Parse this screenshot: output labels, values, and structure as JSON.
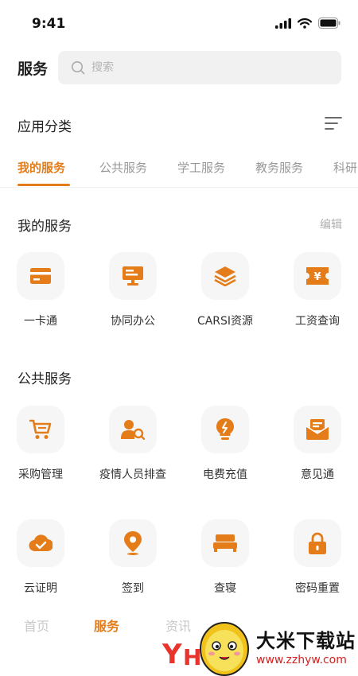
{
  "status_bar": {
    "time": "9:41"
  },
  "header": {
    "title": "服务",
    "search_placeholder": "搜索"
  },
  "category": {
    "title": "应用分类"
  },
  "tabs": [
    {
      "label": "我的服务",
      "active": true
    },
    {
      "label": "公共服务",
      "active": false
    },
    {
      "label": "学工服务",
      "active": false
    },
    {
      "label": "教务服务",
      "active": false
    },
    {
      "label": "科研",
      "active": false
    }
  ],
  "my_services": {
    "title": "我的服务",
    "action": "编辑",
    "items": [
      {
        "label": "一卡通",
        "icon": "card-icon"
      },
      {
        "label": "协同办公",
        "icon": "monitor-icon"
      },
      {
        "label": "CARSI资源",
        "icon": "layers-icon"
      },
      {
        "label": "工资查询",
        "icon": "yuan-ticket-icon"
      }
    ]
  },
  "public_services": {
    "title": "公共服务",
    "items": [
      {
        "label": "采购管理",
        "icon": "cart-icon"
      },
      {
        "label": "疫情人员排查",
        "icon": "person-search-icon"
      },
      {
        "label": "电费充值",
        "icon": "bulb-icon"
      },
      {
        "label": "意见通",
        "icon": "mail-icon"
      },
      {
        "label": "云证明",
        "icon": "cloud-check-icon"
      },
      {
        "label": "签到",
        "icon": "location-pin-icon"
      },
      {
        "label": "查寝",
        "icon": "bed-icon"
      },
      {
        "label": "密码重置",
        "icon": "lock-icon"
      }
    ]
  },
  "bottom_nav": [
    {
      "label": "首页",
      "active": false
    },
    {
      "label": "服务",
      "active": true
    },
    {
      "label": "资讯",
      "active": false
    }
  ],
  "watermark": {
    "name": "大米下载站",
    "url": "www.zzhyw.com"
  },
  "colors": {
    "accent": "#e57c1a",
    "icon_bg": "#f6f6f6",
    "text": "#222222",
    "muted": "#999999"
  }
}
